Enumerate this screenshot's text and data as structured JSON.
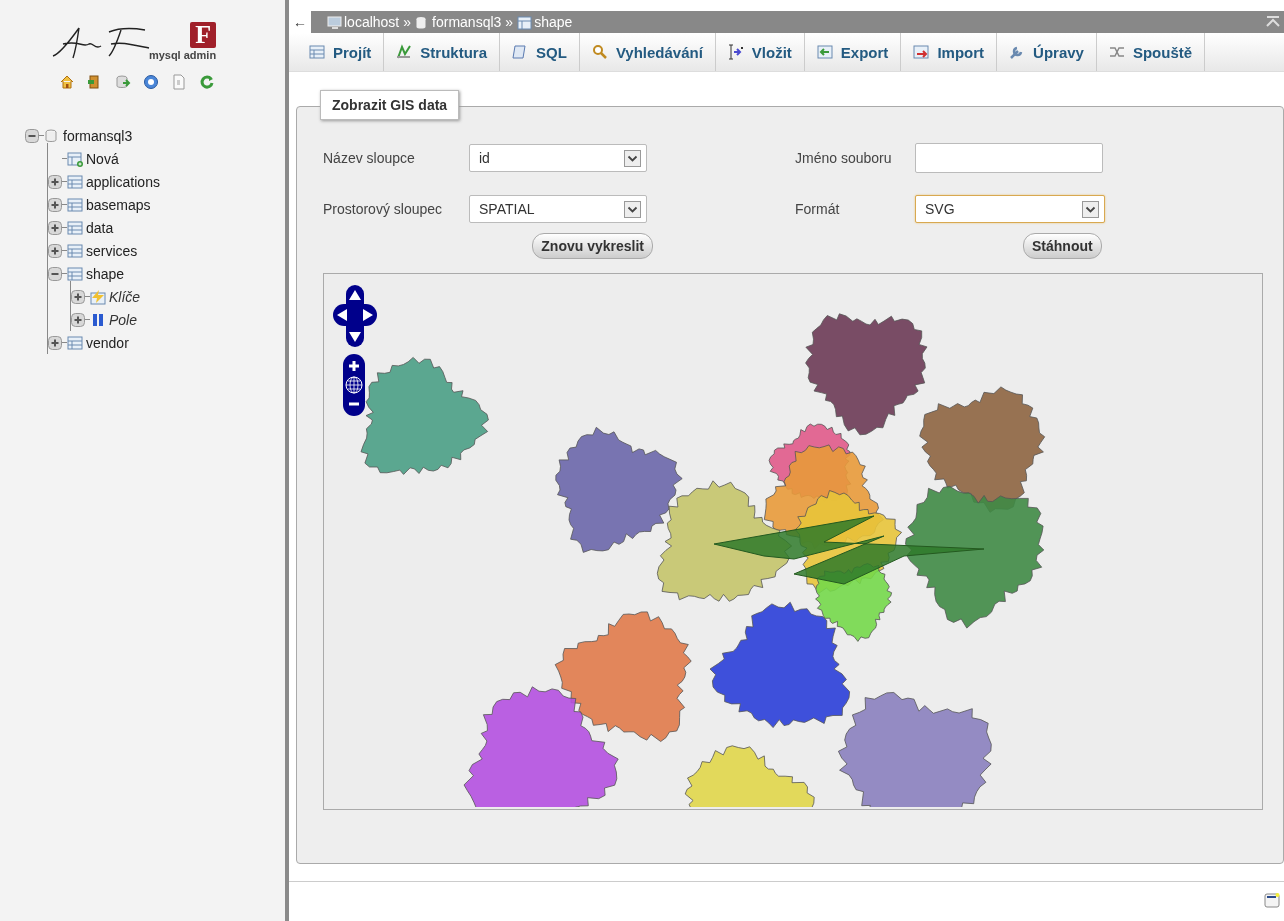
{
  "logo": {
    "letter": "F",
    "caption": "mysql admin"
  },
  "sidebar_icons": [
    {
      "kind": "home"
    },
    {
      "kind": "exit"
    },
    {
      "kind": "database"
    },
    {
      "kind": "help"
    },
    {
      "kind": "document"
    },
    {
      "kind": "refresh"
    }
  ],
  "tree": [
    {
      "label": "formansql3",
      "kind": "database",
      "expanded": true,
      "children": [
        {
          "label": "Nová",
          "kind": "new"
        },
        {
          "label": "applications",
          "kind": "table",
          "expanded": false
        },
        {
          "label": "basemaps",
          "kind": "table",
          "expanded": false
        },
        {
          "label": "data",
          "kind": "table",
          "expanded": false
        },
        {
          "label": "services",
          "kind": "table",
          "expanded": false
        },
        {
          "label": "shape",
          "kind": "table",
          "expanded": true,
          "children": [
            {
              "label": "Klíče",
              "kind": "indexes",
              "expanded": false
            },
            {
              "label": "Pole",
              "kind": "columns",
              "expanded": false
            }
          ]
        },
        {
          "label": "vendor",
          "kind": "table",
          "expanded": false
        }
      ]
    }
  ],
  "breadcrumb": {
    "back": "←",
    "items": [
      {
        "kind": "server",
        "label": "localhost"
      },
      {
        "kind": "separator",
        "label": "»"
      },
      {
        "kind": "database",
        "label": "formansql3"
      },
      {
        "kind": "separator",
        "label": "»"
      },
      {
        "kind": "table",
        "label": "shape"
      }
    ]
  },
  "tabs": [
    {
      "label": "Projít",
      "selected": false
    },
    {
      "label": "Struktura",
      "selected": false
    },
    {
      "label": "SQL",
      "selected": false
    },
    {
      "label": "Vyhledávání",
      "selected": false
    },
    {
      "label": "Vložit",
      "selected": false
    },
    {
      "label": "Export",
      "selected": false
    },
    {
      "label": "Import",
      "selected": false
    },
    {
      "label": "Úpravy",
      "selected": false
    },
    {
      "label": "Spouště",
      "selected": false
    }
  ],
  "panel": {
    "legend": "Zobrazit GIS data",
    "fields": [
      {
        "label": "Název sloupce",
        "kind": "select",
        "value": "id",
        "focused": false
      },
      {
        "label": "Jméno souboru",
        "kind": "text",
        "focused": false
      },
      {
        "label": "Prostorový sloupec",
        "kind": "select",
        "value": "SPATIAL",
        "focused": false
      },
      {
        "label": "Formát",
        "kind": "select",
        "value": "SVG",
        "focused": true
      }
    ],
    "buttons": [
      "Znovu vykreslit",
      "Stáhnout"
    ]
  }
}
